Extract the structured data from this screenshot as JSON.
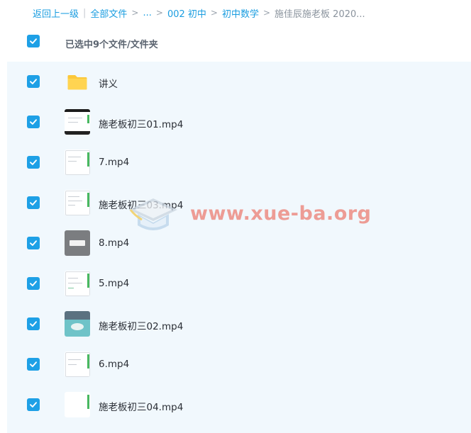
{
  "breadcrumb": {
    "back": "返回上一级",
    "items": [
      "全部文件",
      "...",
      "002 初中",
      "初中数学",
      "施佳辰施老板 2020..."
    ]
  },
  "header": {
    "selected_text": "已选中9个文件/文件夹"
  },
  "files": [
    {
      "name": "讲义",
      "thumb": "folder-icon"
    },
    {
      "name": "施老板初三01.mp4",
      "thumb": "video-thumbnail-dark"
    },
    {
      "name": "7.mp4",
      "thumb": "video-thumbnail-slide"
    },
    {
      "name": "施老板初三03.mp4",
      "thumb": "video-thumbnail-slide"
    },
    {
      "name": "8.mp4",
      "thumb": "video-thumbnail-gray"
    },
    {
      "name": "5.mp4",
      "thumb": "video-thumbnail-slide"
    },
    {
      "name": "施老板初三02.mp4",
      "thumb": "video-thumbnail-scene"
    },
    {
      "name": "6.mp4",
      "thumb": "video-thumbnail-slide"
    },
    {
      "name": "施老板初三04.mp4",
      "thumb": "video-thumbnail-blank"
    }
  ],
  "watermark": {
    "text": "www.xue-ba.org"
  },
  "colors": {
    "accent": "#1ea0e6",
    "list_bg": "#f1f8fd",
    "folder": "#fcc83a"
  }
}
